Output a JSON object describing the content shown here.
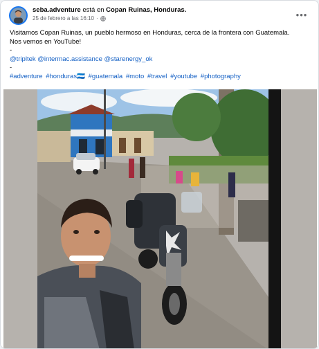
{
  "post": {
    "author": "seba.adventure",
    "status_word": "está en",
    "location": "Copan Ruinas, Honduras.",
    "date": "25 de febrero a las 16:10",
    "separator": "·",
    "more_label": "•••",
    "text_line1": "Visitamos Copan Ruinas, un pueblo hermoso en Honduras, cerca de la frontera con Guatemala.",
    "text_line2": "Nos vemos en YouTube!",
    "dash": "-",
    "mentions": [
      "@tripltek",
      "@intermac.assistance",
      "@starenergy_ok"
    ],
    "hashtags": [
      "#adventure",
      "#honduras🇭🇳",
      "#guatemala",
      "#moto",
      "#travel",
      "#youtube",
      "#photography"
    ]
  },
  "colors": {
    "link": "#1561c5",
    "secondary_text": "#65676b",
    "card_bg": "#ffffff"
  },
  "icons": {
    "more": "more-options-icon",
    "audience": "globe-icon"
  }
}
